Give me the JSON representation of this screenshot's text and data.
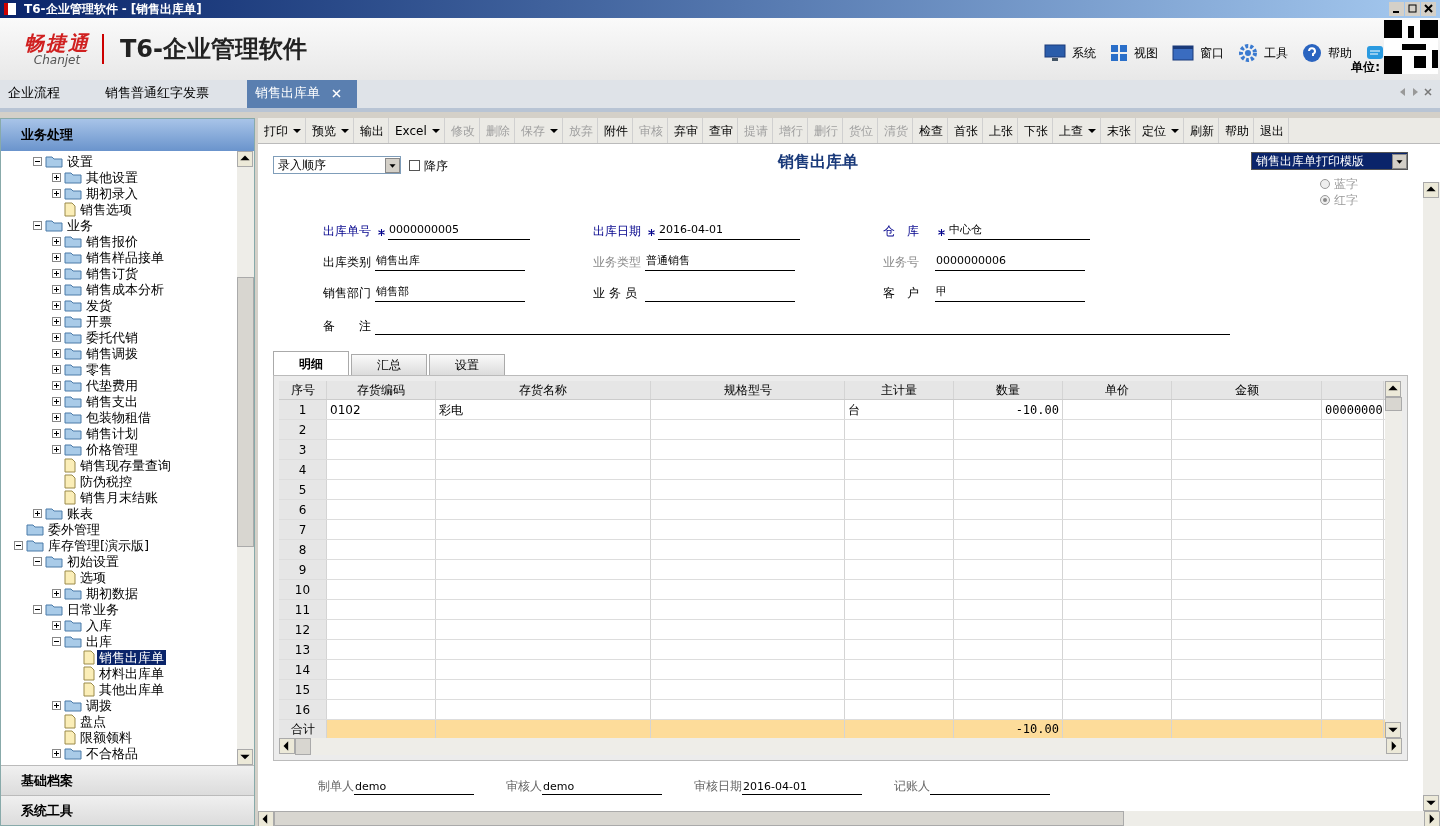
{
  "window": {
    "title": "T6-企业管理软件 - [销售出库单]"
  },
  "header": {
    "brand": "畅捷通",
    "brand_en": "Chanjet",
    "product": "T6-企业管理软件",
    "unit_label": "单位:",
    "menu": [
      {
        "label": "系统",
        "kind": "monitor"
      },
      {
        "label": "视图",
        "kind": "grid"
      },
      {
        "label": "窗口",
        "kind": "window"
      },
      {
        "label": "工具",
        "kind": "gear"
      },
      {
        "label": "帮助",
        "kind": "help"
      }
    ]
  },
  "tabs": [
    {
      "label": "企业流程",
      "selected": false,
      "closable": false
    },
    {
      "label": "销售普通红字发票",
      "selected": false,
      "closable": false
    },
    {
      "label": "销售出库单",
      "selected": true,
      "closable": true
    }
  ],
  "sidebar": {
    "title": "业务处理",
    "sections": [
      "基础档案",
      "系统工具"
    ],
    "tree": [
      {
        "children": [
          {
            "label": "设置",
            "kind": "folder",
            "expanded": true,
            "children": [
              {
                "label": "其他设置",
                "kind": "folder",
                "expanded": false
              },
              {
                "label": "期初录入",
                "kind": "folder",
                "expanded": false
              },
              {
                "label": "销售选项",
                "kind": "document"
              }
            ]
          },
          {
            "label": "业务",
            "kind": "folder",
            "expanded": true,
            "children": [
              {
                "label": "销售报价",
                "kind": "folder",
                "expanded": false
              },
              {
                "label": "销售样品接单",
                "kind": "folder",
                "expanded": false
              },
              {
                "label": "销售订货",
                "kind": "folder",
                "expanded": false
              },
              {
                "label": "销售成本分析",
                "kind": "folder",
                "expanded": false
              },
              {
                "label": "发货",
                "kind": "folder",
                "expanded": false
              },
              {
                "label": "开票",
                "kind": "folder",
                "expanded": false
              },
              {
                "label": "委托代销",
                "kind": "folder",
                "expanded": false
              },
              {
                "label": "销售调拨",
                "kind": "folder",
                "expanded": false
              },
              {
                "label": "零售",
                "kind": "folder",
                "expanded": false
              },
              {
                "label": "代垫费用",
                "kind": "folder",
                "expanded": false
              },
              {
                "label": "销售支出",
                "kind": "folder",
                "expanded": false
              },
              {
                "label": "包装物租借",
                "kind": "folder",
                "expanded": false
              },
              {
                "label": "销售计划",
                "kind": "folder",
                "expanded": false
              },
              {
                "label": "价格管理",
                "kind": "folder",
                "expanded": false
              },
              {
                "label": "销售现存量查询",
                "kind": "document"
              },
              {
                "label": "防伪税控",
                "kind": "document"
              },
              {
                "label": "销售月末结账",
                "kind": "document"
              }
            ]
          },
          {
            "label": "账表",
            "kind": "folder",
            "expanded": false
          }
        ]
      },
      {
        "label": "委外管理",
        "kind": "folder"
      },
      {
        "label": "库存管理[演示版]",
        "kind": "folder",
        "expanded": true,
        "children": [
          {
            "label": "初始设置",
            "kind": "folder",
            "expanded": true,
            "children": [
              {
                "label": "选项",
                "kind": "document"
              },
              {
                "label": "期初数据",
                "kind": "folder",
                "expanded": false
              }
            ]
          },
          {
            "label": "日常业务",
            "kind": "folder",
            "expanded": true,
            "children": [
              {
                "label": "入库",
                "kind": "folder",
                "expanded": false
              },
              {
                "label": "出库",
                "kind": "folder",
                "expanded": true,
                "children": [
                  {
                    "label": "销售出库单",
                    "kind": "document",
                    "selected": true
                  },
                  {
                    "label": "材料出库单",
                    "kind": "document",
                    "selected": false
                  },
                  {
                    "label": "其他出库单",
                    "kind": "document",
                    "selected": false
                  }
                ]
              },
              {
                "label": "调拨",
                "kind": "folder",
                "expanded": false
              },
              {
                "label": "盘点",
                "kind": "document"
              },
              {
                "label": "限额领料",
                "kind": "document"
              },
              {
                "label": "不合格品",
                "kind": "folder",
                "expanded": false
              }
            ]
          }
        ]
      }
    ]
  },
  "toolbar": [
    {
      "label": "打印",
      "disabled": false,
      "dropdown": true
    },
    {
      "label": "预览",
      "disabled": false,
      "dropdown": true
    },
    {
      "label": "输出",
      "disabled": false,
      "dropdown": false
    },
    {
      "label": "Excel",
      "disabled": false,
      "dropdown": true
    },
    {
      "label": "修改",
      "disabled": true,
      "dropdown": false
    },
    {
      "label": "删除",
      "disabled": true,
      "dropdown": false
    },
    {
      "label": "保存",
      "disabled": true,
      "dropdown": true
    },
    {
      "label": "放弃",
      "disabled": true,
      "dropdown": false
    },
    {
      "label": "附件",
      "disabled": false,
      "dropdown": false
    },
    {
      "label": "审核",
      "disabled": true,
      "dropdown": false
    },
    {
      "label": "弃审",
      "disabled": false,
      "dropdown": false
    },
    {
      "label": "查审",
      "disabled": false,
      "dropdown": false
    },
    {
      "label": "提请",
      "disabled": true,
      "dropdown": false
    },
    {
      "label": "增行",
      "disabled": true,
      "dropdown": false
    },
    {
      "label": "删行",
      "disabled": true,
      "dropdown": false
    },
    {
      "label": "货位",
      "disabled": true,
      "dropdown": false
    },
    {
      "label": "清货",
      "disabled": true,
      "dropdown": false
    },
    {
      "label": "检查",
      "disabled": false,
      "dropdown": false
    },
    {
      "label": "首张",
      "disabled": false,
      "dropdown": false
    },
    {
      "label": "上张",
      "disabled": false,
      "dropdown": false
    },
    {
      "label": "下张",
      "disabled": false,
      "dropdown": false
    },
    {
      "label": "上查",
      "disabled": false,
      "dropdown": true
    },
    {
      "label": "末张",
      "disabled": false,
      "dropdown": false
    },
    {
      "label": "定位",
      "disabled": false,
      "dropdown": true
    },
    {
      "label": "刷新",
      "disabled": false,
      "dropdown": false
    },
    {
      "label": "帮助",
      "disabled": false,
      "dropdown": false
    },
    {
      "label": "退出",
      "disabled": false,
      "dropdown": false
    }
  ],
  "form": {
    "title": "销售出库单",
    "order_select": "录入顺序",
    "descending": {
      "label": "降序",
      "checked": false
    },
    "template_select": "销售出库单打印模版",
    "radios": [
      {
        "label": "蓝字",
        "selected": false
      },
      {
        "label": "红字",
        "selected": true
      }
    ],
    "field_rows": [
      [
        {
          "label": "出库单号",
          "required": true,
          "disabled": false,
          "value": "0000000005"
        },
        {
          "label": "出库日期",
          "required": true,
          "disabled": false,
          "value": "2016-04-01"
        },
        {
          "label": "仓　库",
          "required": true,
          "disabled": false,
          "value": "中心仓"
        }
      ],
      [
        {
          "label": "出库类别",
          "required": false,
          "disabled": false,
          "value": "销售出库"
        },
        {
          "label": "业务类型",
          "required": false,
          "disabled": true,
          "value": "普通销售"
        },
        {
          "label": "业务号",
          "required": false,
          "disabled": true,
          "value": "0000000006"
        }
      ],
      [
        {
          "label": "销售部门",
          "required": false,
          "disabled": false,
          "value": "销售部"
        },
        {
          "label": "业 务 员",
          "required": false,
          "disabled": false
        },
        {
          "label": "客　户",
          "required": false,
          "disabled": false,
          "value": "甲"
        }
      ]
    ],
    "remark": {
      "label": "备　　注"
    },
    "detail_tabs": [
      {
        "label": "明细",
        "selected": true
      },
      {
        "label": "汇总",
        "selected": false
      },
      {
        "label": "设置",
        "selected": false
      }
    ],
    "table": {
      "columns": [
        "序号",
        "存货编码",
        "存货名称",
        "规格型号",
        "主计量",
        "数量",
        "单价",
        "金额"
      ],
      "rows": [
        {
          "number": "1",
          "cells": {
            "1": "0102",
            "2": "彩电",
            "4": "台",
            "5": "-10.00",
            "8": "00000000"
          }
        },
        {
          "number": "2"
        },
        {
          "number": "3"
        },
        {
          "number": "4"
        },
        {
          "number": "5"
        },
        {
          "number": "6"
        },
        {
          "number": "7"
        },
        {
          "number": "8"
        },
        {
          "number": "9"
        },
        {
          "number": "10"
        },
        {
          "number": "11"
        },
        {
          "number": "12"
        },
        {
          "number": "13"
        },
        {
          "number": "14"
        },
        {
          "number": "15"
        },
        {
          "number": "16"
        }
      ],
      "total": {
        "label": "合计",
        "cells": {
          "5": "-10.00"
        }
      }
    },
    "signatures": [
      {
        "label": "制单人",
        "value": "demo"
      },
      {
        "label": "审核人",
        "value": "demo"
      },
      {
        "label": "审核日期",
        "value": "2016-04-01"
      },
      {
        "label": "记账人"
      }
    ]
  }
}
